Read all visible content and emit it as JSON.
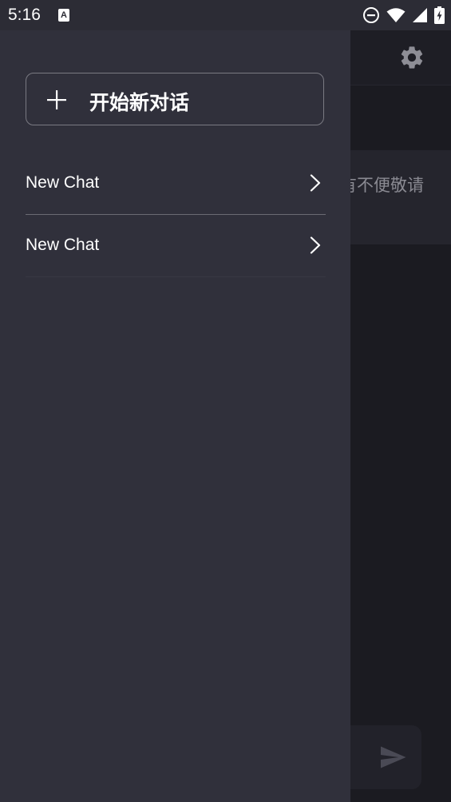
{
  "status_bar": {
    "time": "5:16",
    "app_icon_letter": "A"
  },
  "main": {
    "notice_text": "有不便敬请",
    "settings_icon": "gear-icon",
    "send_icon": "send-icon"
  },
  "drawer": {
    "new_chat_label": "开始新对话",
    "new_chat_icon": "plus-icon",
    "chats": [
      {
        "title": "New Chat"
      },
      {
        "title": "New Chat"
      }
    ]
  },
  "colors": {
    "drawer_bg": "#30303b",
    "screen_bg": "#1b1b21",
    "status_bar_bg": "#2c2c35",
    "text_primary": "#ffffff",
    "text_muted": "#8a8a92"
  }
}
